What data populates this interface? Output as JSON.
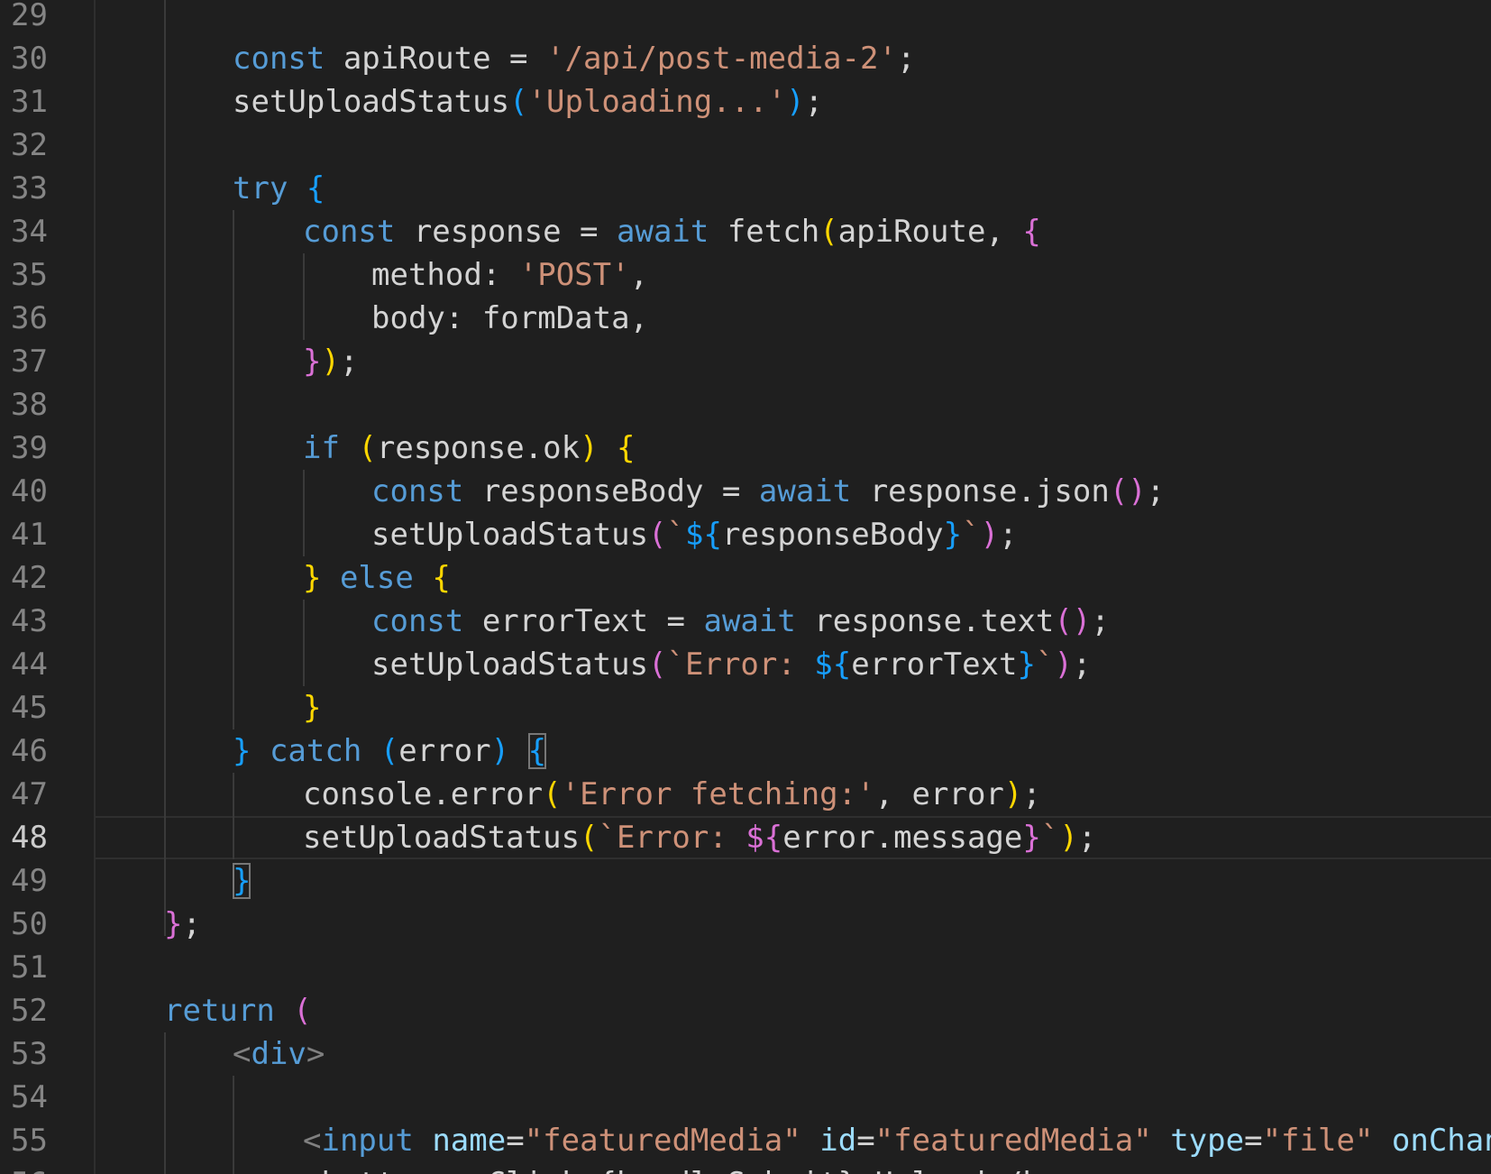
{
  "editor": {
    "current_line": "48",
    "line_numbers": [
      "29",
      "30",
      "31",
      "32",
      "33",
      "34",
      "35",
      "36",
      "37",
      "38",
      "39",
      "40",
      "41",
      "42",
      "43",
      "44",
      "45",
      "46",
      "47",
      "48",
      "49",
      "50",
      "51",
      "52",
      "53",
      "54",
      "55",
      "56"
    ],
    "lines": [
      [],
      [
        {
          "t": "const",
          "c": "kw"
        },
        {
          "t": " apiRoute = ",
          "c": "plain"
        },
        {
          "t": "'/api/post-media-2'",
          "c": "str"
        },
        {
          "t": ";",
          "c": "plain"
        }
      ],
      [
        {
          "t": "setUploadStatus",
          "c": "plain"
        },
        {
          "t": "(",
          "c": "b3"
        },
        {
          "t": "'Uploading...'",
          "c": "str"
        },
        {
          "t": ")",
          "c": "b3"
        },
        {
          "t": ";",
          "c": "plain"
        }
      ],
      [],
      [
        {
          "t": "try ",
          "c": "kw"
        },
        {
          "t": "{",
          "c": "b3"
        }
      ],
      [
        {
          "t": "const",
          "c": "kw"
        },
        {
          "t": " response = ",
          "c": "plain"
        },
        {
          "t": "await",
          "c": "kw"
        },
        {
          "t": " fetch",
          "c": "plain"
        },
        {
          "t": "(",
          "c": "b1"
        },
        {
          "t": "apiRoute, ",
          "c": "plain"
        },
        {
          "t": "{",
          "c": "b2"
        }
      ],
      [
        {
          "t": "method: ",
          "c": "plain"
        },
        {
          "t": "'POST'",
          "c": "str"
        },
        {
          "t": ",",
          "c": "plain"
        }
      ],
      [
        {
          "t": "body: formData,",
          "c": "plain"
        }
      ],
      [
        {
          "t": "}",
          "c": "b2"
        },
        {
          "t": ")",
          "c": "b1"
        },
        {
          "t": ";",
          "c": "plain"
        }
      ],
      [],
      [
        {
          "t": "if ",
          "c": "kw"
        },
        {
          "t": "(",
          "c": "b1"
        },
        {
          "t": "response.ok",
          "c": "plain"
        },
        {
          "t": ")",
          "c": "b1"
        },
        {
          "t": " ",
          "c": "plain"
        },
        {
          "t": "{",
          "c": "b1"
        }
      ],
      [
        {
          "t": "const",
          "c": "kw"
        },
        {
          "t": " responseBody = ",
          "c": "plain"
        },
        {
          "t": "await",
          "c": "kw"
        },
        {
          "t": " response.json",
          "c": "plain"
        },
        {
          "t": "()",
          "c": "b2"
        },
        {
          "t": ";",
          "c": "plain"
        }
      ],
      [
        {
          "t": "setUploadStatus",
          "c": "plain"
        },
        {
          "t": "(",
          "c": "b2"
        },
        {
          "t": "`",
          "c": "str"
        },
        {
          "t": "${",
          "c": "b3"
        },
        {
          "t": "responseBody",
          "c": "plain"
        },
        {
          "t": "}",
          "c": "b3"
        },
        {
          "t": "`",
          "c": "str"
        },
        {
          "t": ")",
          "c": "b2"
        },
        {
          "t": ";",
          "c": "plain"
        }
      ],
      [
        {
          "t": "}",
          "c": "b1"
        },
        {
          "t": " else ",
          "c": "kw"
        },
        {
          "t": "{",
          "c": "b1"
        }
      ],
      [
        {
          "t": "const",
          "c": "kw"
        },
        {
          "t": " errorText = ",
          "c": "plain"
        },
        {
          "t": "await",
          "c": "kw"
        },
        {
          "t": " response.text",
          "c": "plain"
        },
        {
          "t": "()",
          "c": "b2"
        },
        {
          "t": ";",
          "c": "plain"
        }
      ],
      [
        {
          "t": "setUploadStatus",
          "c": "plain"
        },
        {
          "t": "(",
          "c": "b2"
        },
        {
          "t": "`Error: ",
          "c": "str"
        },
        {
          "t": "${",
          "c": "b3"
        },
        {
          "t": "errorText",
          "c": "plain"
        },
        {
          "t": "}",
          "c": "b3"
        },
        {
          "t": "`",
          "c": "str"
        },
        {
          "t": ")",
          "c": "b2"
        },
        {
          "t": ";",
          "c": "plain"
        }
      ],
      [
        {
          "t": "}",
          "c": "b1"
        }
      ],
      [
        {
          "t": "}",
          "c": "b3"
        },
        {
          "t": " catch ",
          "c": "kw"
        },
        {
          "t": "(",
          "c": "b3"
        },
        {
          "t": "error",
          "c": "plain"
        },
        {
          "t": ")",
          "c": "b3"
        },
        {
          "t": " ",
          "c": "plain"
        },
        {
          "t": "{",
          "c": "b3",
          "m": true
        }
      ],
      [
        {
          "t": "console.error",
          "c": "plain"
        },
        {
          "t": "(",
          "c": "b1"
        },
        {
          "t": "'Error fetching:'",
          "c": "str"
        },
        {
          "t": ", error",
          "c": "plain"
        },
        {
          "t": ")",
          "c": "b1"
        },
        {
          "t": ";",
          "c": "plain"
        }
      ],
      [
        {
          "t": "setUploadStatus",
          "c": "plain"
        },
        {
          "t": "(",
          "c": "b1"
        },
        {
          "t": "`Error: ",
          "c": "str"
        },
        {
          "t": "${",
          "c": "b2"
        },
        {
          "t": "error.message",
          "c": "plain"
        },
        {
          "t": "}",
          "c": "b2"
        },
        {
          "t": "`",
          "c": "str"
        },
        {
          "t": ")",
          "c": "b1"
        },
        {
          "t": ";",
          "c": "plain"
        }
      ],
      [
        {
          "t": "}",
          "c": "b3",
          "m": true
        }
      ],
      [
        {
          "t": "}",
          "c": "b2"
        },
        {
          "t": ";",
          "c": "plain"
        }
      ],
      [],
      [
        {
          "t": "return ",
          "c": "kw"
        },
        {
          "t": "(",
          "c": "b2"
        }
      ],
      [
        {
          "t": "<",
          "c": "tag"
        },
        {
          "t": "div",
          "c": "tagname"
        },
        {
          "t": ">",
          "c": "tag"
        }
      ],
      [],
      [
        {
          "t": "<",
          "c": "tag"
        },
        {
          "t": "input",
          "c": "tagname"
        },
        {
          "t": " ",
          "c": "plain"
        },
        {
          "t": "name",
          "c": "attr"
        },
        {
          "t": "=",
          "c": "plain"
        },
        {
          "t": "\"featuredMedia\"",
          "c": "str"
        },
        {
          "t": " ",
          "c": "plain"
        },
        {
          "t": "id",
          "c": "attr"
        },
        {
          "t": "=",
          "c": "plain"
        },
        {
          "t": "\"featuredMedia\"",
          "c": "str"
        },
        {
          "t": " ",
          "c": "plain"
        },
        {
          "t": "type",
          "c": "attr"
        },
        {
          "t": "=",
          "c": "plain"
        },
        {
          "t": "\"file\"",
          "c": "str"
        },
        {
          "t": " ",
          "c": "plain"
        },
        {
          "t": "onChange",
          "c": "attr"
        },
        {
          "t": "=",
          "c": "plain"
        },
        {
          "t": "{",
          "c": "b3"
        }
      ],
      [
        {
          "t": "<button onClick={handleSubmit}>Upload</b",
          "c": "plain"
        }
      ]
    ]
  }
}
